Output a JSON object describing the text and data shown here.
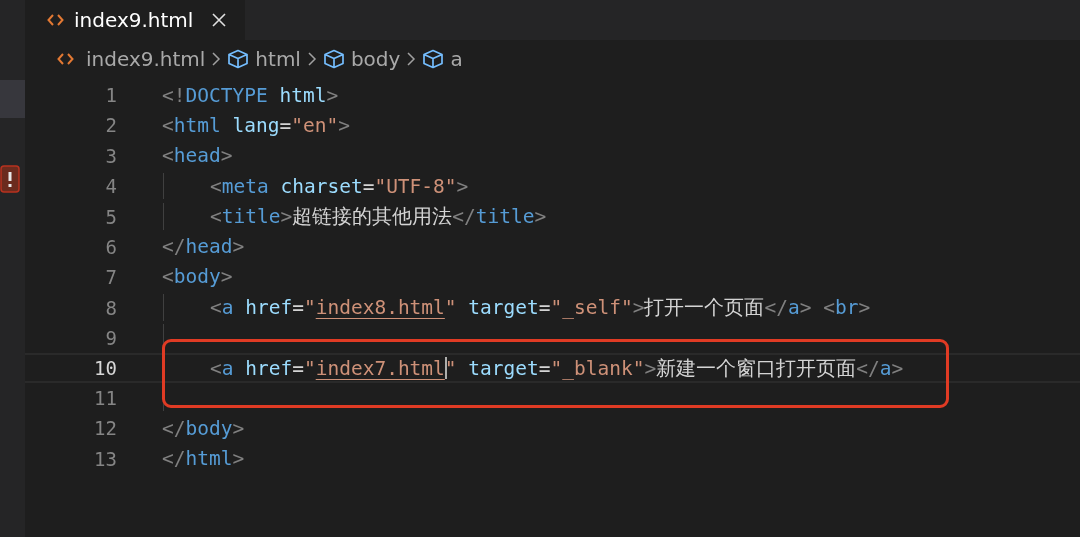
{
  "tabs": [
    {
      "label": "index9.html",
      "selected": true
    }
  ],
  "breadcrumb": [
    {
      "kind": "file",
      "label": "index9.html"
    },
    {
      "kind": "element",
      "label": "html"
    },
    {
      "kind": "element",
      "label": "body"
    },
    {
      "kind": "element",
      "label": "a"
    }
  ],
  "lines": [
    {
      "number": "1",
      "current": false,
      "highlighted": false,
      "tokens": [
        {
          "kind": "punct",
          "text": "<!"
        },
        {
          "kind": "tag",
          "text": "DOCTYPE"
        },
        {
          "kind": "attr",
          "text": " html"
        },
        {
          "kind": "punct",
          "text": ">"
        }
      ]
    },
    {
      "number": "2",
      "current": false,
      "highlighted": false,
      "tokens": [
        {
          "kind": "punct",
          "text": "<"
        },
        {
          "kind": "tag",
          "text": "html"
        },
        {
          "kind": "attr",
          "text": " lang"
        },
        {
          "kind": "plain",
          "text": "="
        },
        {
          "kind": "string",
          "text": "\"en\""
        },
        {
          "kind": "punct",
          "text": ">"
        }
      ]
    },
    {
      "number": "3",
      "current": false,
      "highlighted": false,
      "tokens": [
        {
          "kind": "punct",
          "text": "<"
        },
        {
          "kind": "tag",
          "text": "head"
        },
        {
          "kind": "punct",
          "text": ">"
        }
      ],
      "children": [
        {
          "number": "4",
          "current": false,
          "highlighted": false,
          "tokens": [
            {
              "kind": "punct",
              "text": "<"
            },
            {
              "kind": "tag",
              "text": "meta"
            },
            {
              "kind": "attr",
              "text": " charset"
            },
            {
              "kind": "plain",
              "text": "="
            },
            {
              "kind": "string",
              "text": "\"UTF-8\""
            },
            {
              "kind": "punct",
              "text": ">"
            }
          ]
        },
        {
          "number": "5",
          "current": false,
          "highlighted": false,
          "tokens": [
            {
              "kind": "punct",
              "text": "<"
            },
            {
              "kind": "tag",
              "text": "title"
            },
            {
              "kind": "punct",
              "text": ">"
            },
            {
              "kind": "plain",
              "text": "超链接的其他用法"
            },
            {
              "kind": "punct",
              "text": "</"
            },
            {
              "kind": "tag",
              "text": "title"
            },
            {
              "kind": "punct",
              "text": ">"
            }
          ]
        }
      ]
    },
    {
      "number": "6",
      "current": false,
      "highlighted": false,
      "tokens": [
        {
          "kind": "punct",
          "text": "</"
        },
        {
          "kind": "tag",
          "text": "head"
        },
        {
          "kind": "punct",
          "text": ">"
        }
      ]
    },
    {
      "number": "7",
      "current": false,
      "highlighted": false,
      "tokens": [
        {
          "kind": "punct",
          "text": "<"
        },
        {
          "kind": "tag",
          "text": "body"
        },
        {
          "kind": "punct",
          "text": ">"
        }
      ],
      "children": [
        {
          "number": "8",
          "current": false,
          "highlighted": false,
          "tokens": [
            {
              "kind": "punct",
              "text": "<"
            },
            {
              "kind": "tag",
              "text": "a"
            },
            {
              "kind": "attr",
              "text": " href"
            },
            {
              "kind": "plain",
              "text": "="
            },
            {
              "kind": "string",
              "text": "\""
            },
            {
              "kind": "link",
              "text": "index8.html",
              "cursor": false
            },
            {
              "kind": "string",
              "text": "\""
            },
            {
              "kind": "attr",
              "text": " target"
            },
            {
              "kind": "plain",
              "text": "="
            },
            {
              "kind": "string",
              "text": "\"_self\""
            },
            {
              "kind": "punct",
              "text": ">"
            },
            {
              "kind": "plain",
              "text": "打开一个页面"
            },
            {
              "kind": "punct",
              "text": "</"
            },
            {
              "kind": "tag",
              "text": "a"
            },
            {
              "kind": "punct",
              "text": ">"
            },
            {
              "kind": "punct",
              "text": " <"
            },
            {
              "kind": "tag",
              "text": "br"
            },
            {
              "kind": "punct",
              "text": ">"
            }
          ]
        },
        {
          "number": "9",
          "current": false,
          "highlighted": false
        },
        {
          "number": "10",
          "current": true,
          "highlighted": true,
          "tokens": [
            {
              "kind": "punct",
              "text": "<"
            },
            {
              "kind": "tag",
              "text": "a"
            },
            {
              "kind": "attr",
              "text": " href"
            },
            {
              "kind": "plain",
              "text": "="
            },
            {
              "kind": "string",
              "text": "\""
            },
            {
              "kind": "link",
              "text": "index7.html",
              "cursor": true
            },
            {
              "kind": "string",
              "text": "\""
            },
            {
              "kind": "attr",
              "text": " target"
            },
            {
              "kind": "plain",
              "text": "="
            },
            {
              "kind": "string",
              "text": "\"_blank\""
            },
            {
              "kind": "punct",
              "text": ">"
            },
            {
              "kind": "plain",
              "text": "新建一个窗口打开页面"
            },
            {
              "kind": "punct",
              "text": "</"
            },
            {
              "kind": "tag",
              "text": "a"
            },
            {
              "kind": "punct",
              "text": ">"
            }
          ]
        },
        {
          "number": "11",
          "current": false,
          "highlighted": true
        }
      ]
    },
    {
      "number": "12",
      "current": false,
      "highlighted": false,
      "tokens": [
        {
          "kind": "punct",
          "text": "</"
        },
        {
          "kind": "tag",
          "text": "body"
        },
        {
          "kind": "punct",
          "text": ">"
        }
      ]
    },
    {
      "number": "13",
      "current": false,
      "highlighted": false,
      "tokens": [
        {
          "kind": "punct",
          "text": "</"
        },
        {
          "kind": "tag",
          "text": "html"
        },
        {
          "kind": "punct",
          "text": ">"
        }
      ]
    }
  ]
}
